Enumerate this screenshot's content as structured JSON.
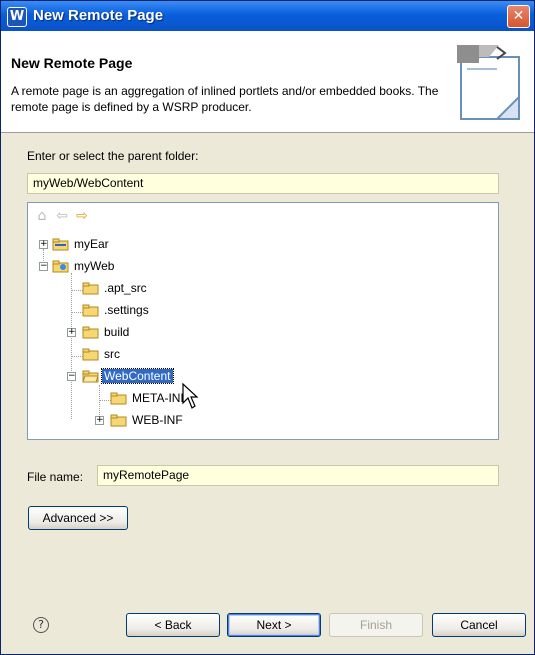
{
  "window": {
    "title": "New Remote Page",
    "app_icon_glyph": "W",
    "close_glyph": "✕"
  },
  "banner": {
    "title": "New Remote Page",
    "description": "A remote page is an aggregation of inlined portlets and/or embedded books. The remote page is defined by a WSRP producer."
  },
  "folder_select": {
    "label": "Enter or select the parent folder:",
    "value": "myWeb/WebContent"
  },
  "tree": {
    "nav_icons": [
      "home-icon",
      "back-arrow-icon",
      "forward-arrow-icon"
    ],
    "items": [
      {
        "label": "myEar",
        "expander": "+",
        "icon": "ear-project-icon"
      },
      {
        "label": "myWeb",
        "expander": "−",
        "icon": "web-project-icon"
      },
      {
        "label": ".apt_src",
        "expander": "",
        "icon": "folder-icon"
      },
      {
        "label": ".settings",
        "expander": "",
        "icon": "folder-icon"
      },
      {
        "label": "build",
        "expander": "+",
        "icon": "folder-icon"
      },
      {
        "label": "src",
        "expander": "",
        "icon": "folder-icon"
      },
      {
        "label": "WebContent",
        "expander": "−",
        "icon": "folder-icon",
        "selected": true
      },
      {
        "label": "META-INF",
        "expander": "",
        "icon": "folder-icon"
      },
      {
        "label": "WEB-INF",
        "expander": "+",
        "icon": "folder-icon"
      }
    ]
  },
  "file_name": {
    "label": "File name:",
    "value": "myRemotePage"
  },
  "buttons": {
    "advanced": "Advanced >>",
    "back": "< Back",
    "next": "Next >",
    "finish": "Finish",
    "cancel": "Cancel",
    "help_glyph": "?"
  },
  "colors": {
    "title_bar": "#0a5fdc",
    "selection": "#316ac5",
    "field_background": "#ffffde",
    "dialog_background": "#ece9d8"
  }
}
